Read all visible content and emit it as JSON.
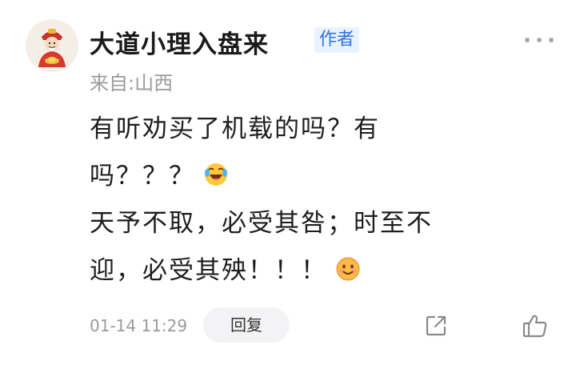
{
  "comment": {
    "author": "大道小理入盘来",
    "author_badge": "作者",
    "location": "来自:山西",
    "lines": [
      "有听劝买了机载的吗？有",
      "吗？？？",
      "天予不取，必受其咎；时至不",
      "迎，必受其殃！！！"
    ],
    "emojis": [
      "laughing-crying-emoji",
      "smiling-emoji"
    ],
    "timestamp": "01-14 11:29",
    "reply_label": "回复"
  },
  "icons": {
    "more": "more-dots-icon",
    "share": "share-icon",
    "like": "thumbs-up-icon"
  },
  "colors": {
    "badge_text": "#2f74e6",
    "badge_bg": "#e9f2ff",
    "muted_text": "#9a9a9a"
  }
}
